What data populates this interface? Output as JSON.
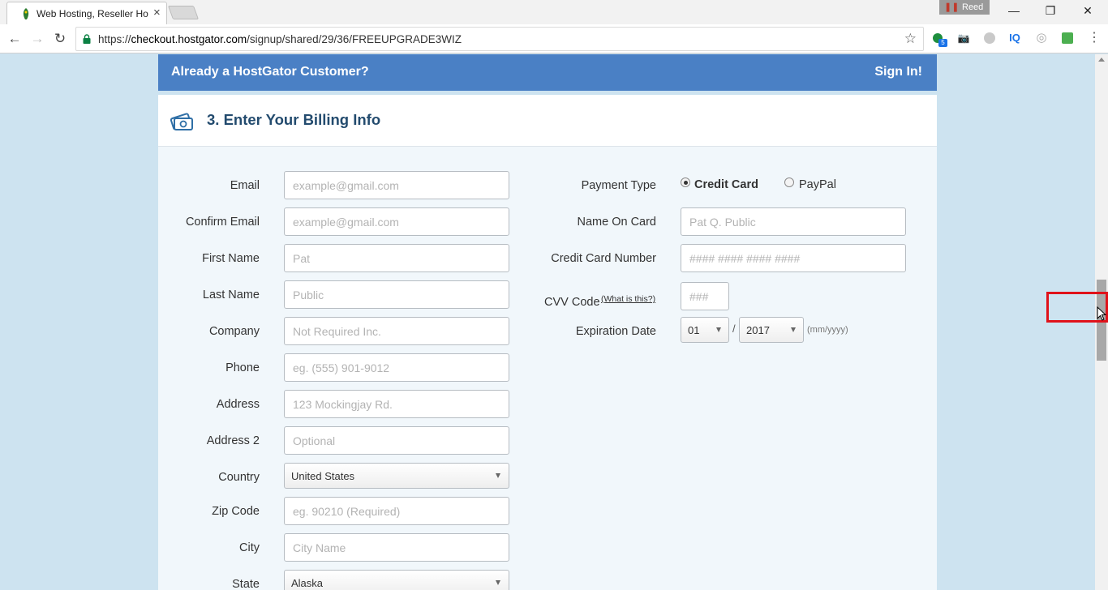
{
  "browser": {
    "tab_title": "Web Hosting, Reseller Ho",
    "tab_close": "×",
    "profile_name": "Reed",
    "profile_icon": "pause-icon",
    "window_controls": {
      "minimize": "—",
      "restore": "❐",
      "close": "✕"
    },
    "url_prefix": "https://",
    "url_host": "checkout.hostgator.com",
    "url_path": "/signup/shared/29/36/FREEUPGRADE3WIZ",
    "extensions": [
      "green-badge-icon",
      "camera-icon",
      "gray-extension-icon",
      "iq-icon",
      "swirl-icon",
      "green-square-icon",
      "menu-icon"
    ],
    "extension_badge": "5",
    "iq_label": "IQ"
  },
  "page": {
    "customer_prompt": "Already a HostGator Customer?",
    "sign_in": "Sign In!",
    "section_title": "3. Enter Your Billing Info"
  },
  "billing": {
    "email": {
      "label": "Email",
      "placeholder": "example@gmail.com"
    },
    "confirm_email": {
      "label": "Confirm Email",
      "placeholder": "example@gmail.com"
    },
    "first_name": {
      "label": "First Name",
      "placeholder": "Pat"
    },
    "last_name": {
      "label": "Last Name",
      "placeholder": "Public"
    },
    "company": {
      "label": "Company",
      "placeholder": "Not Required Inc."
    },
    "phone": {
      "label": "Phone",
      "placeholder": "eg. (555) 901-9012"
    },
    "address": {
      "label": "Address",
      "placeholder": "123 Mockingjay Rd."
    },
    "address2": {
      "label": "Address 2",
      "placeholder": "Optional"
    },
    "country": {
      "label": "Country",
      "value": "United States"
    },
    "zip": {
      "label": "Zip Code",
      "placeholder": "eg. 90210 (Required)"
    },
    "city": {
      "label": "City",
      "placeholder": "City Name"
    },
    "state": {
      "label": "State",
      "value": "Alaska"
    }
  },
  "payment": {
    "type_label": "Payment Type",
    "credit_card": "Credit Card",
    "paypal": "PayPal",
    "selected": "Credit Card",
    "name_on_card": {
      "label": "Name On Card",
      "placeholder": "Pat Q. Public"
    },
    "card_number": {
      "label": "Credit Card Number",
      "placeholder": "#### #### #### ####"
    },
    "cvv": {
      "label": "CVV Code",
      "help": "(What is this?)",
      "placeholder": "###"
    },
    "expiration": {
      "label": "Expiration Date",
      "month": "01",
      "separator": "/",
      "year": "2017",
      "format": "(mm/yyyy)"
    }
  },
  "colors": {
    "header_blue": "#4a80c5",
    "title_navy": "#234b6e",
    "page_background": "#cde3f0",
    "form_background": "#f1f7fb",
    "highlight_red": "#e0121a"
  }
}
